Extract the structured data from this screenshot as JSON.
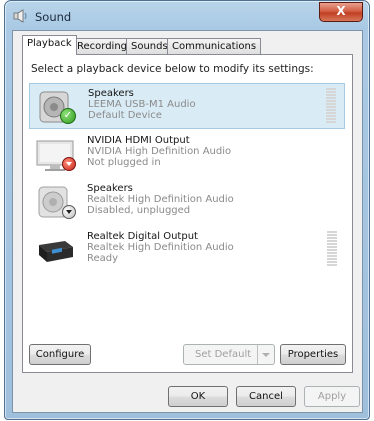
{
  "window": {
    "title": "Sound",
    "close_glyph": "X"
  },
  "tabs": [
    {
      "label": "Playback",
      "active": true
    },
    {
      "label": "Recording",
      "active": false
    },
    {
      "label": "Sounds",
      "active": false
    },
    {
      "label": "Communications",
      "active": false
    }
  ],
  "panel": {
    "instruction": "Select a playback device below to modify its settings:",
    "devices": [
      {
        "name": "Speakers",
        "driver": "LEEMA USB-M1 Audio",
        "status": "Default Device",
        "icon": "speaker-icon",
        "badge": "default-check-icon",
        "selected": true
      },
      {
        "name": "NVIDIA HDMI Output",
        "driver": "NVIDIA High Definition Audio",
        "status": "Not plugged in",
        "icon": "monitor-icon",
        "badge": "not-plugged-icon",
        "selected": false
      },
      {
        "name": "Speakers",
        "driver": "Realtek High Definition Audio",
        "status": "Disabled, unplugged",
        "icon": "speaker-icon",
        "badge": "disabled-icon",
        "selected": false
      },
      {
        "name": "Realtek Digital Output",
        "driver": "Realtek High Definition Audio",
        "status": "Ready",
        "icon": "digital-output-icon",
        "badge": "",
        "selected": false
      }
    ],
    "buttons": {
      "configure": "Configure",
      "set_default": "Set Default",
      "properties": "Properties"
    }
  },
  "footer": {
    "ok": "OK",
    "cancel": "Cancel",
    "apply": "Apply"
  },
  "colors": {
    "selection": "#d9ebf5",
    "title_bar": "#a9c9e4",
    "close_button": "#c13f22",
    "disabled_text": "#a0a0a0"
  }
}
